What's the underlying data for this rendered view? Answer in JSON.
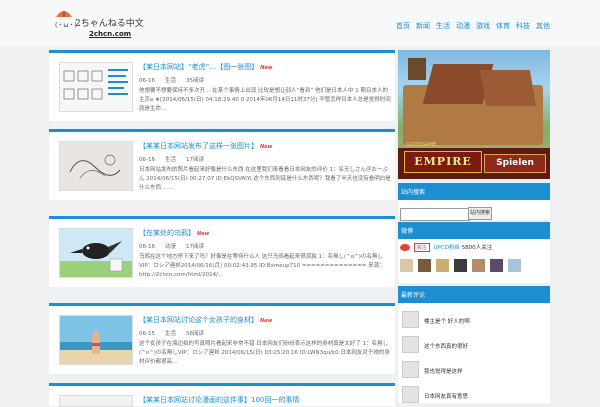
{
  "header": {
    "logo_text": "2ちゃんねる中文",
    "logo_sub": "2chcn.com",
    "logo_face": "(・ω・)",
    "nav": [
      "首页",
      "新闻",
      "生活",
      "动漫",
      "游戏",
      "体育",
      "科技",
      "其他"
    ]
  },
  "posts": [
    {
      "title": "【某日本网站】“老虎”…【图一张图】",
      "badge": "New",
      "date": "06-16",
      "category": "生活",
      "views": "35阅读",
      "excerpt": "他想要不想要保持不多次开…  在某个事情上出现 比较是想让别人“看到”  他们是日本人中 1 期日本人的主页e ★[2014/06/15(日) 04:18:29.40 0 2014年06月14日11时37分] 不管怎样日本人总是觉得时间就是生命…"
    },
    {
      "title": "【某某日本网站发布了这样一张图片】",
      "badge": "New",
      "date": "06-16",
      "category": "生活",
      "views": "17阅读",
      "excerpt": "日本网站发布的照片看起来好像是什么东西 在这里我们来看看日本网友的评价 1：名无しさん＠おーぷん 2014/06/15(日) 00:27:07 ID:EkQSVAlYi 这个东西到底是什么东西呢？我看了半天也没有看明白是什么东西  ……"
    },
    {
      "title": "【在某处的乌鸦】",
      "badge": "New",
      "date": "06-16",
      "category": "动漫",
      "views": "17阅读",
      "excerpt": "乌鸦在这个地方停下来了吗？好像是在等待什么人 这只乌鸦看起来很孤独  1：名無し(^o^)の名無しVIP：ロシア連邦2014/06/16(月) 00:02:43.95 ID:Bxmeup710 ============== 来源：http://2chcn.com/html/2014/…"
    },
    {
      "title": "【某日本网站讨论这个女孩子的身材】",
      "badge": "New",
      "date": "06-15",
      "category": "生活",
      "views": "58阅读",
      "excerpt": "这个女孩子在海边拍的写真照片看起来非常不错 日本网友们纷纷表示这样的身材真是太好了  1：名無し(^o^)の名無しVIP：ロシア連邦 2014/06/15(日) 03:25:20.16 ID:LWN3qu/k0 日本网友对于她的身材评价都很高…"
    },
    {
      "title": "【某某日本网站讨论漫画的这件事】100回一的事情",
      "badge": "",
      "date": "",
      "category": "",
      "views": "",
      "excerpt": ""
    }
  ],
  "sidebar": {
    "ad": {
      "brand": "GOODGAME",
      "title": "EMPIRE",
      "button": "Spielen"
    },
    "search": {
      "heading": "站内搜索",
      "button": "站内搜索",
      "placeholder": ""
    },
    "weibo": {
      "heading": "微博",
      "follow": "关注",
      "name": "UPCD粉丝",
      "count": "5800",
      "suffix": "人关注"
    },
    "comments": {
      "heading": "最新评论",
      "items": [
        "楼主是个 好人的啊",
        "这个东西真的很好",
        "我也觉得是这样",
        "日本网友真有意思"
      ]
    }
  },
  "colors": {
    "accent": "#1b8fd2",
    "new_badge": "#e23b3b"
  }
}
